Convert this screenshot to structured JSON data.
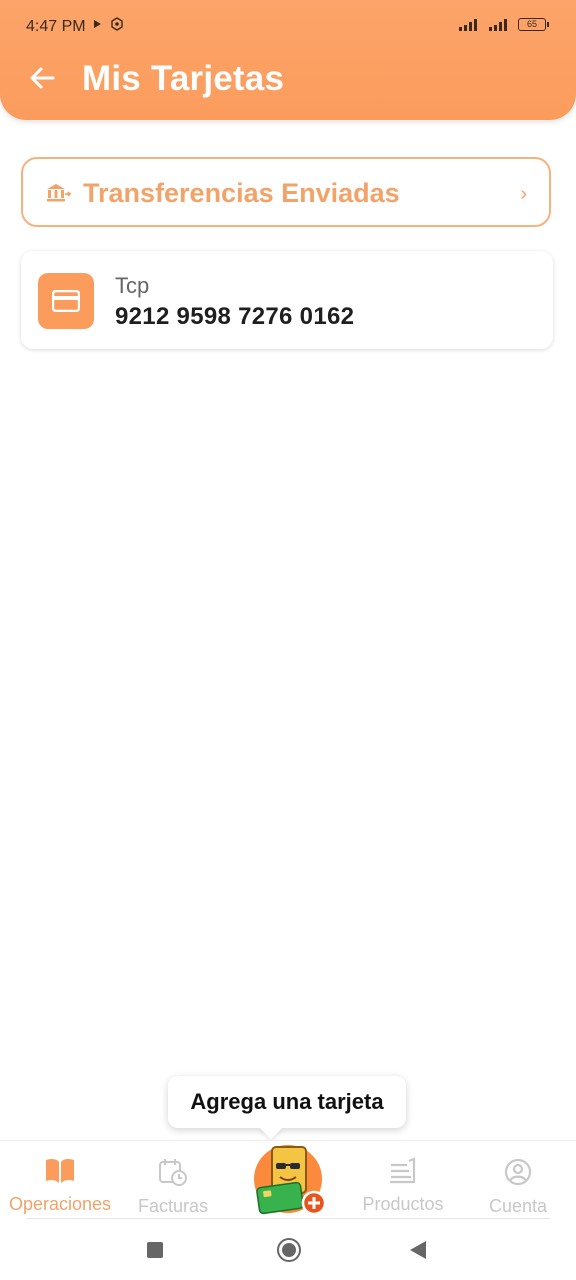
{
  "status_bar": {
    "time": "4:47 PM",
    "battery": "65"
  },
  "header": {
    "title": "Mis Tarjetas",
    "back_icon": "arrow-left-icon"
  },
  "transfers": {
    "label": "Transferencias Enviadas",
    "icon": "bank-transfer-icon",
    "chevron": "›"
  },
  "cards": [
    {
      "bank": "Tcp",
      "number": "9212 9598 7276 0162",
      "icon": "credit-card-icon"
    }
  ],
  "tooltip": {
    "text": "Agrega una tarjeta"
  },
  "bottom_nav": {
    "items": [
      {
        "label": "Operaciones",
        "icon": "book-icon",
        "active": true
      },
      {
        "label": "Facturas",
        "icon": "calendar-clock-icon",
        "active": false
      },
      {
        "label": "Productos",
        "icon": "products-icon",
        "active": false
      },
      {
        "label": "Cuenta",
        "icon": "user-circle-icon",
        "active": false
      }
    ],
    "center_action_icon": "add-card-mascot-icon"
  },
  "colors": {
    "accent": "#fb9c5c",
    "accent_text": "#f2a36a",
    "inactive": "#c8c8c8"
  }
}
